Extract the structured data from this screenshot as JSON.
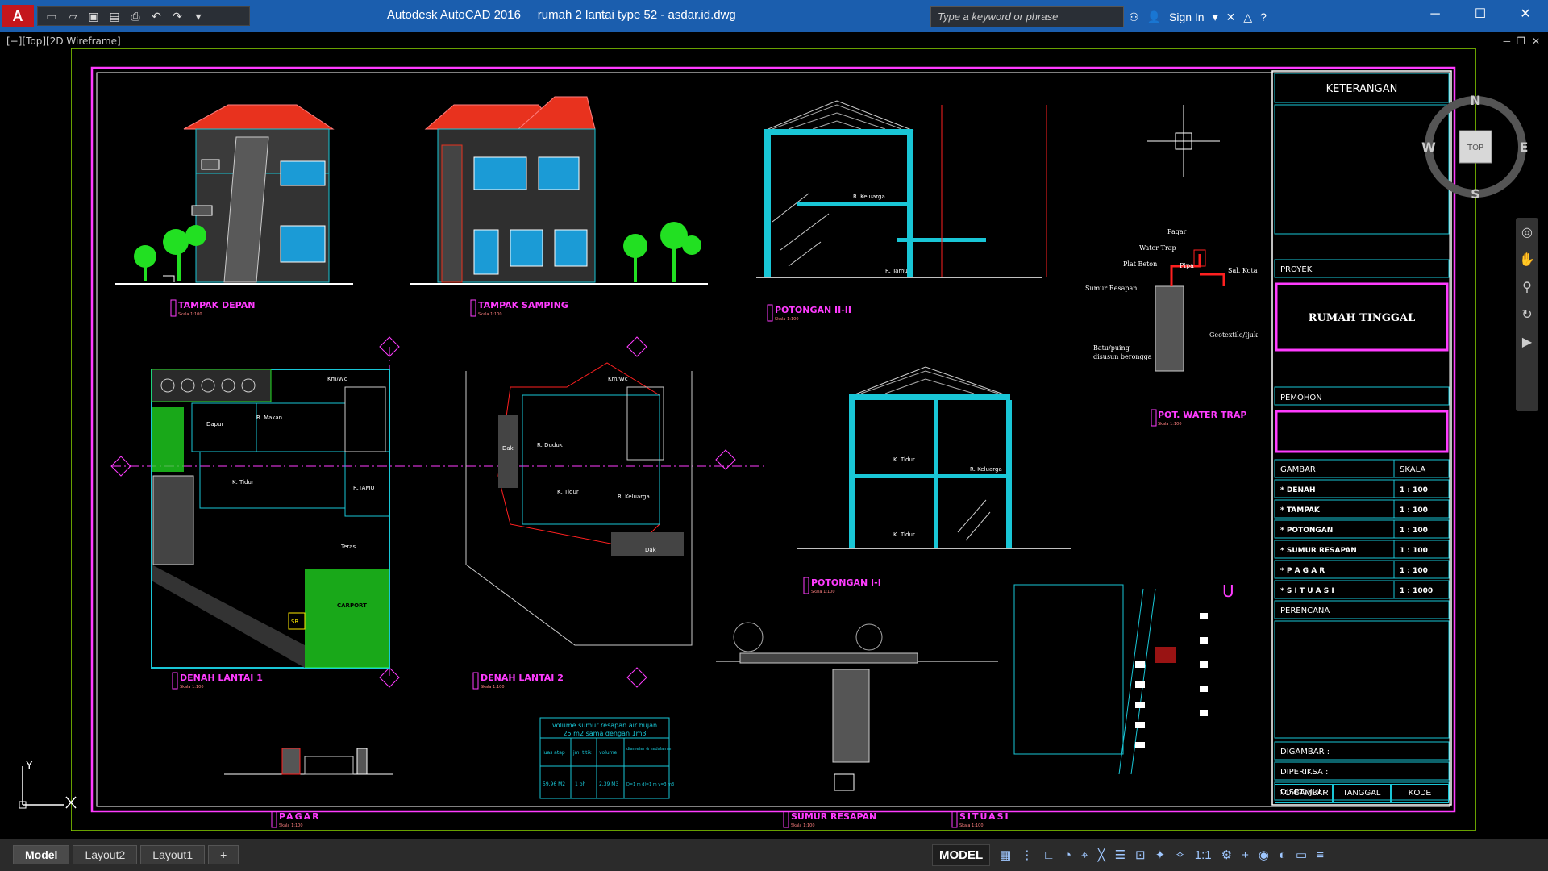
{
  "app": {
    "logo": "A",
    "title": "Autodesk AutoCAD 2016",
    "file": "rumah 2 lantai type 52 - asdar.id.dwg",
    "search_placeholder": "Type a keyword or phrase",
    "sign_in": "Sign In"
  },
  "viewport": {
    "label": "[−][Top][2D Wireframe]",
    "ucs_y": "Y"
  },
  "viewcube": {
    "n": "N",
    "s": "S",
    "e": "E",
    "w": "W",
    "top": "TOP"
  },
  "drawing_labels": {
    "tampak_depan": "TAMPAK DEPAN",
    "tampak_samping": "TAMPAK SAMPING",
    "potongan_ii": "POTONGAN II-II",
    "potongan_i": "POTONGAN I-I",
    "denah_1": "DENAH LANTAI 1",
    "denah_2": "DENAH LANTAI 2",
    "pagar": "PAGAR",
    "sumur_resapan": "SUMUR RESAPAN",
    "situasi": "SITUASI",
    "water_trap": "POT. WATER TRAP",
    "skala": "Skala 1:100"
  },
  "rooms": {
    "makan": "R. Makan",
    "dapur": "Dapur",
    "kmwc": "Km/Wc",
    "ktidur": "K. Tidur",
    "tamu": "R.TAMU",
    "teras": "Teras",
    "carport": "CARPORT",
    "duduk": "R. Duduk",
    "keluarga": "R. Keluarga",
    "dak": "Dak",
    "sr": "SR",
    "rkeluarga": "R. Keluarga",
    "rtamu2": "R. Tamu"
  },
  "water_trap_notes": [
    "Pagar",
    "Water Trap",
    "Plat Beton",
    "Pipa",
    "Sal. Kota",
    "Sumur Resapan",
    "Geotextile/Ijuk",
    "Batu/puing",
    "disusun berongga"
  ],
  "volume_table": {
    "title1": "volume sumur resapan air hujan",
    "title2": "25 m2 sama dengan 1m3",
    "headers": [
      "luas atap",
      "jml titik",
      "volume",
      "diameter & kedalaman"
    ],
    "row": [
      "59,96 M2",
      "1 bh",
      "2,39 M3",
      "D=1 m  dl=1 m  v=3 m3"
    ]
  },
  "title_block": {
    "keterangan": "KETERANGAN",
    "proyek": "PROYEK",
    "proyek_name": "RUMAH TINGGAL",
    "pemohon": "PEMOHON",
    "gambar_header": "GAMBAR",
    "skala_header": "SKALA",
    "rows": [
      {
        "gambar": "* DENAH",
        "skala": "1 : 100"
      },
      {
        "gambar": "* TAMPAK",
        "skala": "1 : 100"
      },
      {
        "gambar": "* POTONGAN",
        "skala": "1 : 100"
      },
      {
        "gambar": "* SUMUR RESAPAN",
        "skala": "1 : 100"
      },
      {
        "gambar": "* P A G A R",
        "skala": "1 : 100"
      },
      {
        "gambar": "* S I T U A S I",
        "skala": "1 : 1000"
      }
    ],
    "perencana": "PERENCANA",
    "digambar": "DIGAMBAR   :",
    "diperiksa": "DIPERIKSA   :",
    "disetujui": "DISETUJUI   :",
    "no_gambar": "NO.GAMBAR",
    "tanggal": "TANGGAL",
    "kode": "KODE"
  },
  "layouts": [
    "Model",
    "Layout2",
    "Layout1",
    "+"
  ],
  "status": {
    "model": "MODEL",
    "scale": "1:1"
  },
  "colors": {
    "roof": "#e8321e",
    "wall_cyan": "#19c6d6",
    "frame_magenta": "#ff3cff",
    "tree_green": "#22e022",
    "dim_red": "#ff2020",
    "title_bar": "#1b5eae"
  }
}
